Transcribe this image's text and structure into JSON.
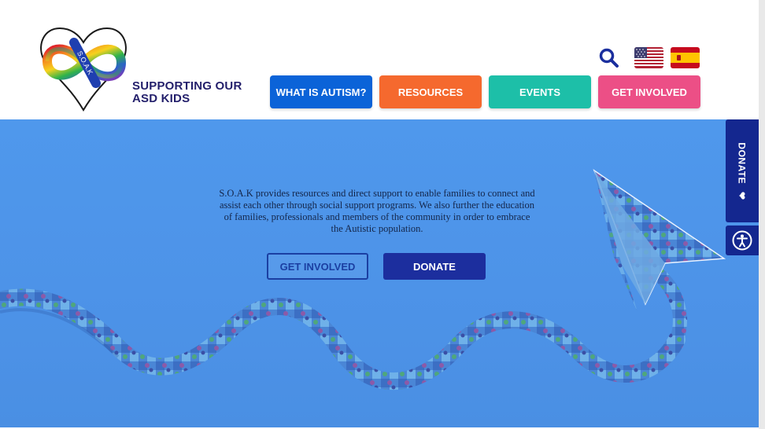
{
  "header": {
    "logo_alt": "S.O.A.K",
    "brand_line1": "SUPPORTING OUR",
    "brand_line2": "ASD KIDS",
    "search_icon": "search-icon",
    "flags": [
      {
        "name": "us-flag-icon",
        "lang": "English"
      },
      {
        "name": "spain-flag-icon",
        "lang": "Spanish"
      }
    ]
  },
  "nav": {
    "items": [
      {
        "label": "WHAT IS AUTISM?",
        "color": "#0b63d8"
      },
      {
        "label": "RESOURCES",
        "color": "#f5692e"
      },
      {
        "label": "EVENTS",
        "color": "#1dbfa8"
      },
      {
        "label": "GET INVOLVED",
        "color": "#ec4f86"
      }
    ]
  },
  "hero": {
    "description": "S.O.A.K provides resources and direct support to enable families to connect and assist each other through social support programs. We also further the education of families, professionals and members of the community in order to embrace the Autistic population.",
    "cta_primary": "GET INVOLVED",
    "cta_secondary": "DONATE",
    "background_color": "#4f98ec"
  },
  "side": {
    "donate_label": "DONATE",
    "donate_icon": "heart-icon",
    "accessibility_icon": "accessibility-icon"
  }
}
